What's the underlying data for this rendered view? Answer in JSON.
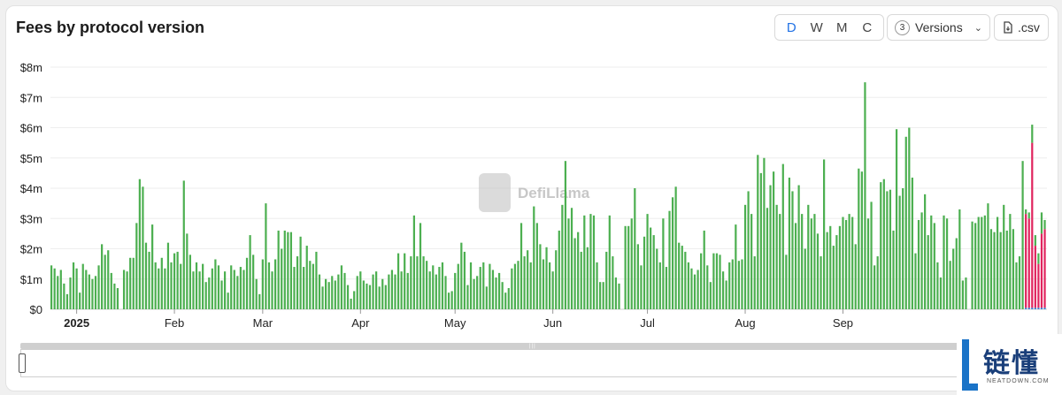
{
  "title": "Fees by protocol version",
  "controls": {
    "granularity": [
      "D",
      "W",
      "M",
      "C"
    ],
    "active": "D",
    "versions_count": "3",
    "versions_label": "Versions",
    "csv_label": ".csv"
  },
  "watermark": "DefiLlama",
  "logo": {
    "cn": "链懂",
    "en": "NEATDOWN.COM"
  },
  "colors": {
    "v_green": "#4CAF50",
    "v_pink": "#E0245E",
    "v_blue": "#2f7fd8",
    "grid": "#eeeeee"
  },
  "chart_data": {
    "type": "bar",
    "stacked": true,
    "title": "Fees by protocol version",
    "ylim": [
      0,
      8
    ],
    "y_ticks": [
      "$0",
      "$1m",
      "$2m",
      "$3m",
      "$4m",
      "$5m",
      "$6m",
      "$7m",
      "$8m"
    ],
    "x_ticks": [
      {
        "label": "2025",
        "day": 8
      },
      {
        "label": "Feb",
        "day": 39
      },
      {
        "label": "Mar",
        "day": 67
      },
      {
        "label": "Apr",
        "day": 98
      },
      {
        "label": "May",
        "day": 128
      },
      {
        "label": "Jun",
        "day": 159
      },
      {
        "label": "Jul",
        "day": 189
      },
      {
        "label": "Aug",
        "day": 220
      },
      {
        "label": "Sep",
        "day": 251
      }
    ],
    "start_date": "2024-12-24",
    "unit": "USD millions",
    "grid": true,
    "series_main": [
      1.45,
      1.35,
      1.1,
      1.3,
      0.85,
      0.5,
      1.05,
      1.55,
      1.35,
      0.55,
      1.5,
      1.3,
      1.15,
      1.0,
      1.1,
      1.45,
      2.15,
      1.8,
      1.95,
      1.2,
      0.85,
      0.7,
      0,
      1.3,
      1.25,
      1.7,
      1.7,
      2.85,
      4.3,
      4.05,
      2.2,
      1.9,
      2.8,
      1.55,
      1.35,
      1.7,
      1.35,
      2.2,
      1.55,
      1.85,
      1.9,
      1.5,
      4.25,
      2.5,
      1.8,
      1.25,
      1.55,
      1.25,
      1.5,
      0.9,
      1.05,
      1.35,
      1.65,
      1.45,
      0.95,
      1.25,
      0.55,
      1.45,
      1.3,
      1.1,
      1.4,
      1.3,
      1.7,
      2.45,
      1.8,
      1.0,
      0.5,
      1.65,
      3.5,
      1.55,
      1.25,
      1.65,
      2.6,
      2.0,
      2.6,
      2.55,
      2.55,
      1.4,
      1.75,
      2.4,
      1.4,
      2.1,
      1.6,
      1.5,
      1.9,
      1.15,
      0.75,
      1.0,
      0.9,
      1.1,
      0.95,
      1.15,
      1.45,
      1.2,
      0.8,
      0.35,
      0.6,
      1.1,
      1.25,
      0.95,
      0.85,
      0.8,
      1.15,
      1.25,
      0.75,
      1.0,
      0.8,
      1.15,
      1.3,
      1.15,
      1.85,
      1.25,
      1.85,
      1.2,
      1.75,
      3.1,
      1.75,
      2.85,
      1.75,
      1.6,
      1.25,
      1.45,
      1.15,
      1.4,
      1.55,
      1.1,
      0.55,
      0.6,
      1.2,
      1.5,
      2.2,
      1.9,
      0.8,
      1.55,
      1.0,
      1.1,
      1.4,
      1.55,
      0.75,
      1.5,
      1.3,
      1.05,
      1.2,
      0.9,
      0.55,
      0.7,
      1.35,
      1.5,
      1.6,
      2.85,
      1.75,
      1.95,
      1.55,
      3.4,
      2.85,
      2.15,
      1.65,
      2.05,
      1.55,
      1.25,
      1.95,
      2.6,
      3.45,
      4.9,
      3.0,
      3.35,
      2.35,
      2.55,
      1.9,
      3.1,
      2.05,
      3.15,
      3.1,
      1.55,
      0.9,
      0.9,
      1.9,
      3.1,
      1.75,
      1.05,
      0.85,
      0,
      2.75,
      2.75,
      3.0,
      4.0,
      2.15,
      1.45,
      2.4,
      3.15,
      2.7,
      2.45,
      2.0,
      1.55,
      3.0,
      1.4,
      3.25,
      3.7,
      4.05,
      2.2,
      2.1,
      1.9,
      1.55,
      1.35,
      1.15,
      1.3,
      1.85,
      2.6,
      1.45,
      0.9,
      1.85,
      1.85,
      1.8,
      1.25,
      0.95,
      1.55,
      1.65,
      2.8,
      1.6,
      1.65,
      3.45,
      3.9,
      3.15,
      1.75,
      5.1,
      4.5,
      5.0,
      3.35,
      4.1,
      4.55,
      3.45,
      3.15,
      4.8,
      1.8,
      4.35,
      3.9,
      2.85,
      4.1,
      3.15,
      2.0,
      3.45,
      3.0,
      3.15,
      2.5,
      1.75,
      4.95,
      2.55,
      2.75,
      2.1,
      2.45,
      2.75,
      3.05,
      2.95,
      3.15,
      3.05,
      2.15,
      4.65,
      4.55,
      7.5,
      3.0,
      3.55,
      1.45,
      1.75,
      4.2,
      4.3,
      3.9,
      3.95,
      2.6,
      5.95,
      3.75,
      4.0,
      5.7,
      6.0,
      4.35,
      1.85,
      2.95,
      3.2,
      3.8,
      2.45,
      3.1,
      2.85,
      1.55,
      1.05,
      3.1,
      3.0,
      1.6,
      2.0,
      2.35,
      3.3,
      0.95,
      1.05,
      0,
      2.9,
      2.85,
      3.05,
      3.05,
      3.1,
      3.5,
      2.65,
      2.55,
      3.05,
      2.55,
      3.45,
      2.6,
      3.15,
      2.65,
      1.55,
      1.75,
      4.9
    ],
    "series_stacked_days": [
      {
        "main": 0.15,
        "pink": 3.1,
        "blue": 0.05
      },
      {
        "main": 0.2,
        "pink": 2.95,
        "blue": 0.05
      },
      {
        "main": 0.6,
        "pink": 5.45,
        "blue": 0.05
      },
      {
        "main": 0.35,
        "pink": 2.05,
        "blue": 0.05
      },
      {
        "main": 0.35,
        "pink": 1.45,
        "blue": 0.05
      },
      {
        "main": 0.7,
        "pink": 2.45,
        "blue": 0.05
      },
      {
        "main": 0.3,
        "pink": 2.6,
        "blue": 0.05
      }
    ]
  }
}
